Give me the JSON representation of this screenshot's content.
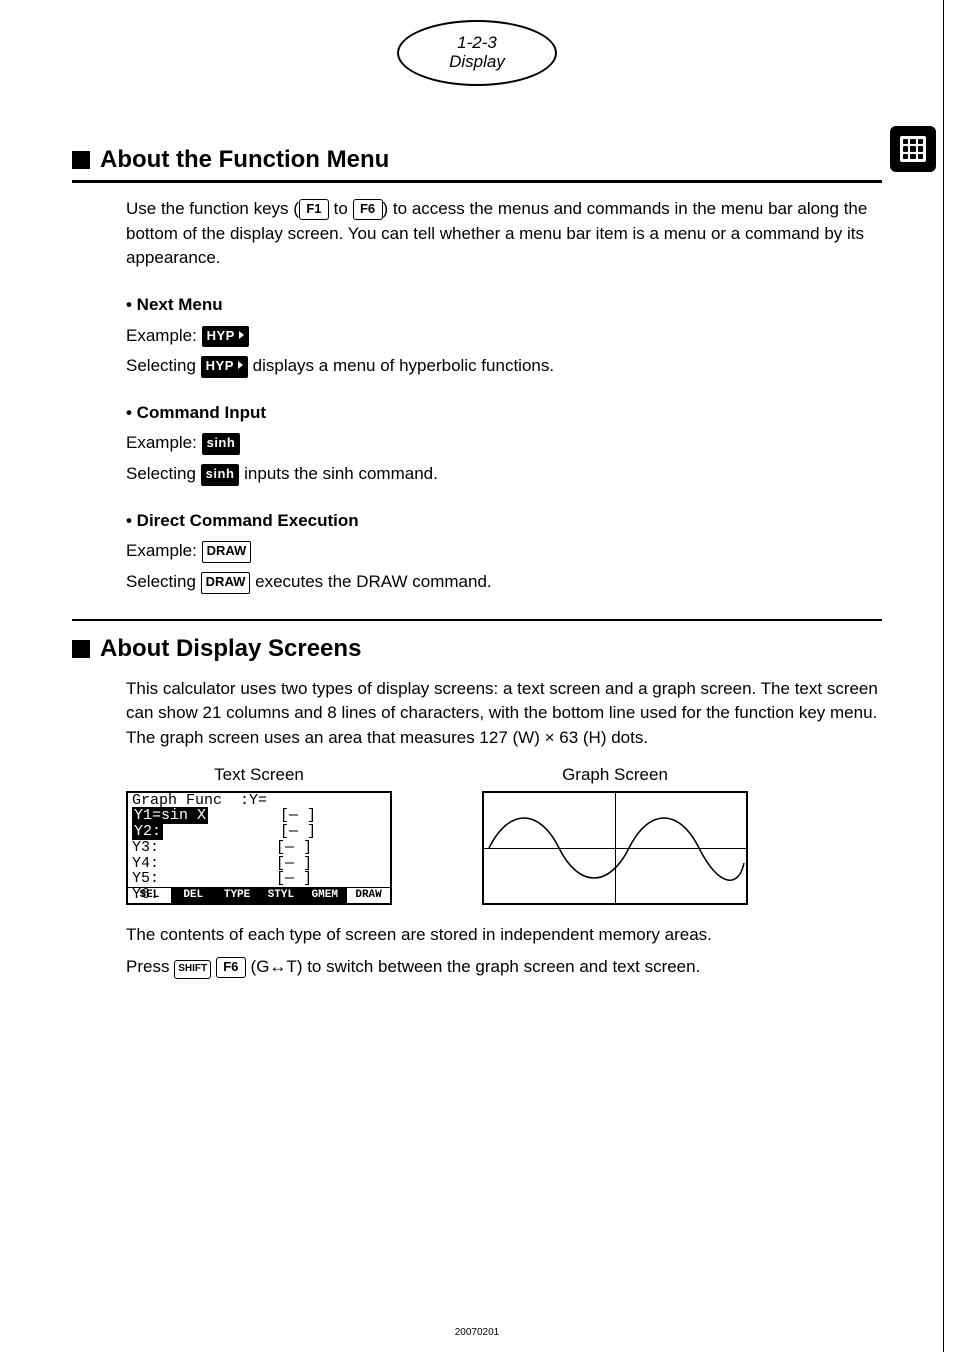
{
  "page_header": {
    "num": "1-2-3",
    "word": "Display"
  },
  "section1": {
    "title": "About the Function Menu",
    "intro_a": "Use the function keys (",
    "key_from": "F1",
    "intro_b": " to ",
    "key_to": "F6",
    "intro_c": ") to access the menus and commands in the menu bar along the bottom of the display screen. You can tell whether a menu bar item is a menu or a command by its appearance.",
    "sub1": {
      "head": "• Next Menu",
      "example_label": "Example: ",
      "btn": "HYP",
      "sel_a": "Selecting ",
      "sel_b": " displays a menu of hyperbolic functions."
    },
    "sub2": {
      "head": "• Command Input",
      "example_label": "Example: ",
      "btn": "sinh",
      "sel_a": "Selecting ",
      "sel_b": " inputs the sinh command."
    },
    "sub3": {
      "head": "• Direct Command Execution",
      "example_label": "Example: ",
      "btn": "DRAW",
      "sel_a": "Selecting ",
      "sel_b": " executes the DRAW command."
    }
  },
  "section2": {
    "title": "About Display Screens",
    "para": "This calculator uses two types of display screens: a text screen and a graph screen. The text screen can show 21 columns and 8 lines of characters, with the bottom line used for the function key menu. The graph screen uses an area that measures 127 (W) × 63 (H) dots.",
    "text_screen_title": "Text Screen",
    "graph_screen_title": "Graph Screen",
    "lcd": {
      "line1_a": "Graph Func  :Y=",
      "line2_sel": "Y1=sin X",
      "line2_rest": "        [— ]",
      "line3_a": "Y2:",
      "line3_rest": "             [— ]",
      "lines_rest": [
        "Y3:             [— ]",
        "Y4:             [— ]",
        "Y5:             [— ]",
        "Y6:             [— ]"
      ],
      "fkeys": [
        "SEL",
        "DEL",
        "TYPE",
        "STYL",
        "GMEM",
        "DRAW"
      ],
      "fkeys_inv": [
        false,
        true,
        true,
        true,
        true,
        false
      ]
    },
    "after1": "The contents of each type of screen are stored in independent memory areas.",
    "after2_a": "Press ",
    "after2_shift": "SHIFT",
    "after2_f6": "F6",
    "after2_mid": "(G↔T) to switch between the graph screen and text screen."
  },
  "footer": "20070201"
}
